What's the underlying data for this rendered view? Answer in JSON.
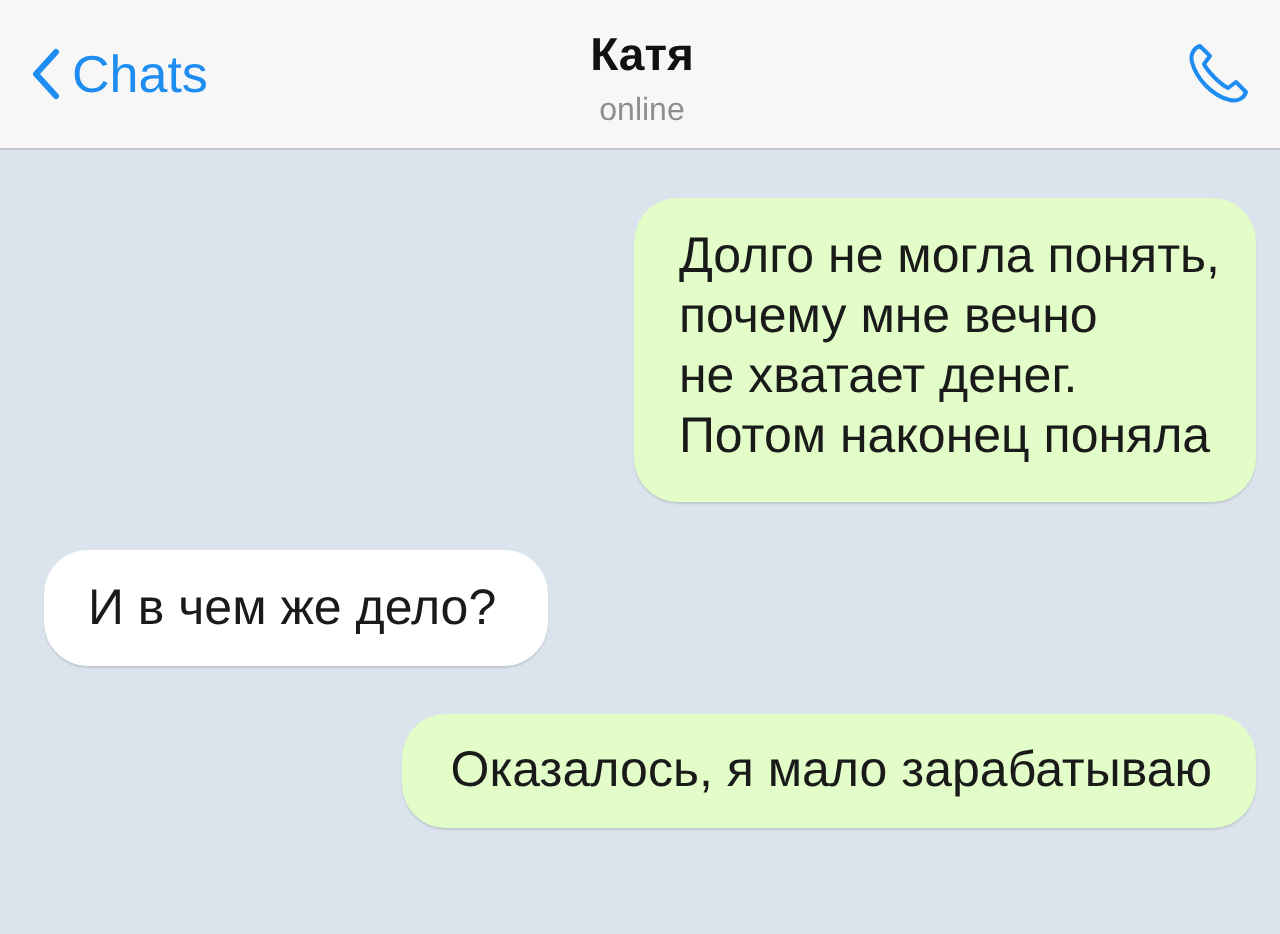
{
  "header": {
    "back_label": "Chats",
    "title": "Катя",
    "status": "online"
  },
  "messages": [
    {
      "kind": "outgoing",
      "text": "Долго не могла понять,\nпочему мне вечно\nне хватает денег.\nПотом наконец поняла"
    },
    {
      "kind": "incoming",
      "text": "И в чем же дело?"
    },
    {
      "kind": "outgoing",
      "text": "Оказалось, я мало зарабатываю"
    }
  ]
}
